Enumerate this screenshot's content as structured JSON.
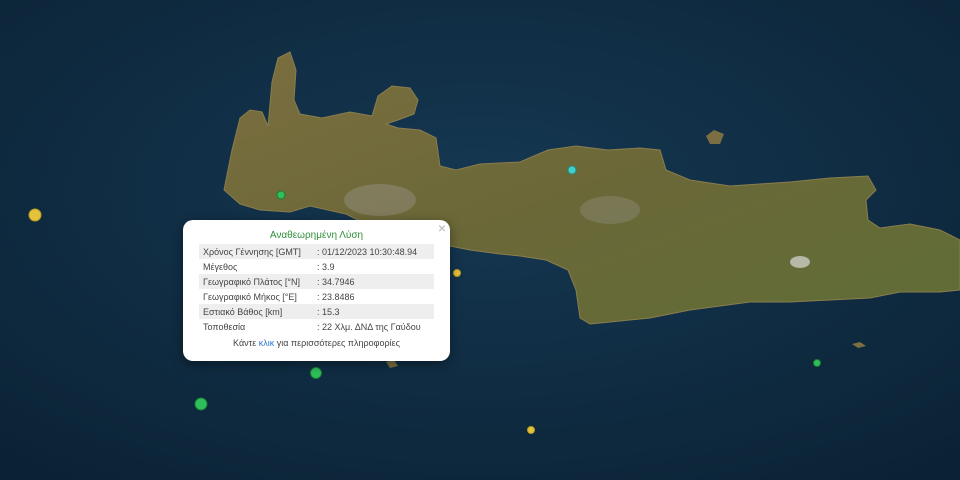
{
  "popup": {
    "title": "Αναθεωρημένη Λύση",
    "close": "×",
    "rows": [
      {
        "label": "Χρόνος Γέννησης [GMT]",
        "value": ": 01/12/2023 10:30:48.94"
      },
      {
        "label": "Μέγεθος",
        "value": ": 3.9"
      },
      {
        "label": "Γεωγραφικό Πλάτος [°N]",
        "value": ": 34.7946"
      },
      {
        "label": "Γεωγραφικό Μήκος [°E]",
        "value": ": 23.8486"
      },
      {
        "label": "Εστιακό Βάθος [km]",
        "value": ": 15.3"
      },
      {
        "label": "Τοποθεσία",
        "value": ": 22 Χλμ. ΔΝΔ της Γαύδου"
      }
    ],
    "more_prefix": "Κάντε ",
    "more_link": "κλικ",
    "more_suffix": " για περισσότερες πληροφορίες"
  },
  "colors": {
    "sea": "#0e2a3f",
    "land": "#6e6a3a",
    "green_marker": "#2fbf5a",
    "yellow_marker": "#e4c23a",
    "cyan_marker": "#3fd0c9",
    "popup_title": "#2f8f3a",
    "link": "#2a7bd6"
  },
  "markers": [
    {
      "type": "yellow",
      "name": "earthquake-marker-yellow"
    },
    {
      "type": "green",
      "name": "earthquake-marker-green"
    },
    {
      "type": "cyan",
      "name": "earthquake-marker-cyan"
    },
    {
      "type": "yellow",
      "name": "earthquake-marker-yellow"
    },
    {
      "type": "green",
      "name": "earthquake-marker-selected"
    },
    {
      "type": "green",
      "name": "earthquake-marker-green"
    },
    {
      "type": "green",
      "name": "earthquake-marker-green"
    },
    {
      "type": "yellow",
      "name": "earthquake-marker-yellow"
    }
  ]
}
